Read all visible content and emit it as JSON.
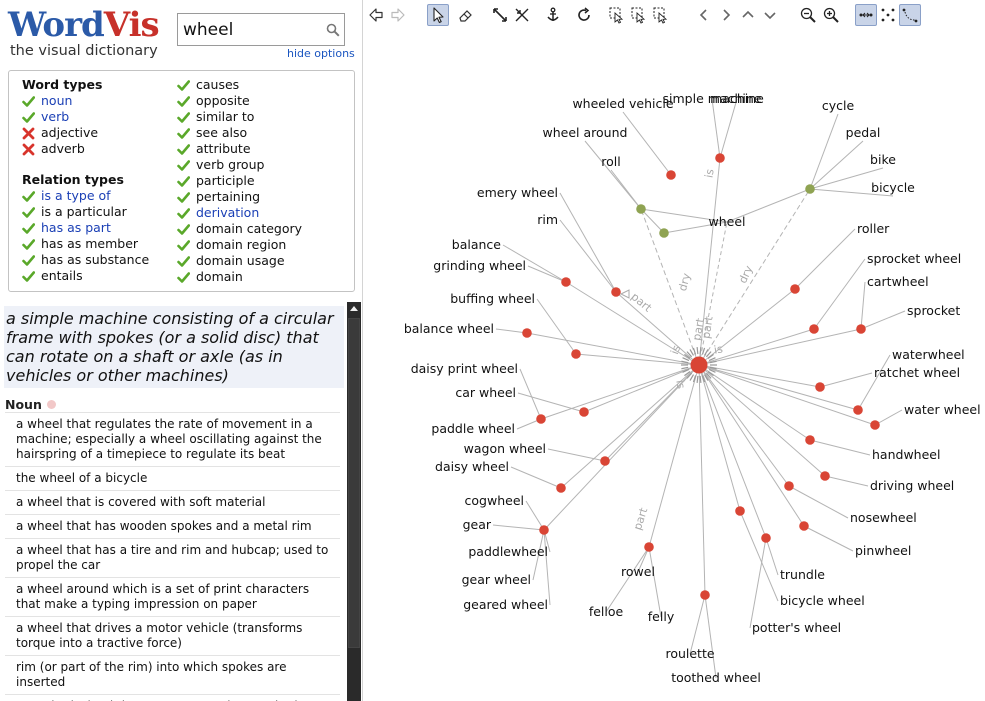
{
  "app": {
    "logo_word_1": "Word",
    "logo_word_2": "Vis",
    "tagline": "the visual dictionary"
  },
  "search": {
    "value": "wheel",
    "icon": "magnifier-icon",
    "hide_options": "hide options"
  },
  "options": {
    "word_types_header": "Word types",
    "word_types": [
      {
        "label": "noun",
        "checked": true,
        "link": true
      },
      {
        "label": "verb",
        "checked": true,
        "link": true
      },
      {
        "label": "adjective",
        "checked": false,
        "link": false
      },
      {
        "label": "adverb",
        "checked": false,
        "link": false
      }
    ],
    "relation_types_header": "Relation types",
    "relation_types": [
      {
        "label": "is a type of",
        "checked": true,
        "link": true
      },
      {
        "label": "is a particular",
        "checked": true,
        "link": false
      },
      {
        "label": "has as part",
        "checked": true,
        "link": true
      },
      {
        "label": "has as member",
        "checked": true,
        "link": false
      },
      {
        "label": "has as substance",
        "checked": true,
        "link": false
      },
      {
        "label": "entails",
        "checked": true,
        "link": false
      }
    ],
    "relation_types_2": [
      {
        "label": "causes",
        "checked": true,
        "link": false
      },
      {
        "label": "opposite",
        "checked": true,
        "link": false
      },
      {
        "label": "similar to",
        "checked": true,
        "link": false
      },
      {
        "label": "see also",
        "checked": true,
        "link": false
      },
      {
        "label": "attribute",
        "checked": true,
        "link": false
      },
      {
        "label": "verb group",
        "checked": true,
        "link": false
      },
      {
        "label": "participle",
        "checked": true,
        "link": false
      },
      {
        "label": "pertaining",
        "checked": true,
        "link": false
      },
      {
        "label": "derivation",
        "checked": true,
        "link": true
      },
      {
        "label": "domain category",
        "checked": true,
        "link": false
      },
      {
        "label": "domain region",
        "checked": true,
        "link": false
      },
      {
        "label": "domain usage",
        "checked": true,
        "link": false
      },
      {
        "label": "domain",
        "checked": true,
        "link": false
      }
    ],
    "icons": {
      "checked": "green-check-icon",
      "unchecked": "red-x-icon"
    },
    "colors": {
      "check": "#5aa82a",
      "cross": "#d8342c",
      "link": "#1a3fb5"
    }
  },
  "definition": "a simple machine consisting of a circular frame with spokes (or a solid disc) that can rotate on a shaft or axle (as in vehicles or other machines)",
  "senses_header": "Noun",
  "senses": [
    "a wheel that regulates the rate of movement in a machine; especially a wheel oscillating against the hairspring of a timepiece to regulate its beat",
    "the wheel of a bicycle",
    "a wheel that is covered with soft material",
    "a wheel that has wooden spokes and a metal rim",
    "a wheel that has a tire and rim and hubcap; used to propel the car",
    "a wheel around which is a set of print characters that make a typing impression on paper",
    "a wheel that drives a motor vehicle (transforms torque into a tractive force)",
    "rim (or part of the rim) into which spokes are inserted",
    "a toothed wheel that engages another toothed mechanism in order to change the speed or direction"
  ],
  "toolbar": [
    {
      "name": "back-icon"
    },
    {
      "name": "forward-icon"
    },
    {
      "name": "select-arrow-icon",
      "active": true
    },
    {
      "name": "eraser-icon"
    },
    {
      "name": "expand-icon"
    },
    {
      "name": "collapse-icon"
    },
    {
      "name": "anchor-icon"
    },
    {
      "name": "refresh-icon"
    },
    {
      "name": "select-n-icon"
    },
    {
      "name": "select-c-icon"
    },
    {
      "name": "select-x-icon"
    },
    {
      "name": "pan-left-icon"
    },
    {
      "name": "pan-right-icon"
    },
    {
      "name": "pan-up-icon"
    },
    {
      "name": "pan-down-icon"
    },
    {
      "name": "zoom-out-icon"
    },
    {
      "name": "zoom-in-icon"
    },
    {
      "name": "layout-spread-icon",
      "active": true
    },
    {
      "name": "layout-scatter-icon"
    },
    {
      "name": "layout-curve-icon",
      "active": true
    }
  ],
  "graph": {
    "colors": {
      "noun_node": "#d94535",
      "verb_node": "#8fa352",
      "edge": "#b4b4b4",
      "hub": "#d94535"
    },
    "center_word": "wheel",
    "verb_hub_label": "wheel",
    "edge_labels": [
      "is",
      "dry",
      "part",
      "part",
      "dry",
      "part",
      "is",
      "is",
      "is",
      "part"
    ],
    "nouns": [
      "simple machine",
      "machine",
      "roller",
      "sprocket wheel",
      "cartwheel",
      "sprocket",
      "waterwheel",
      "ratchet wheel",
      "water wheel",
      "handwheel",
      "driving wheel",
      "nosewheel",
      "pinwheel",
      "trundle",
      "bicycle wheel",
      "potter's wheel",
      "roulette",
      "toothed wheel",
      "rowel",
      "felloe",
      "felly",
      "cogwheel",
      "gear",
      "paddlewheel",
      "gear wheel",
      "geared wheel",
      "wagon wheel",
      "daisy wheel",
      "paddle wheel",
      "car wheel",
      "daisy print wheel",
      "balance wheel",
      "buffing wheel",
      "balance",
      "grinding wheel",
      "emery wheel",
      "rim"
    ],
    "verbs": [
      "wheeled vehicle",
      "wheel around",
      "roll",
      "cycle",
      "pedal",
      "bike",
      "bicycle"
    ]
  }
}
